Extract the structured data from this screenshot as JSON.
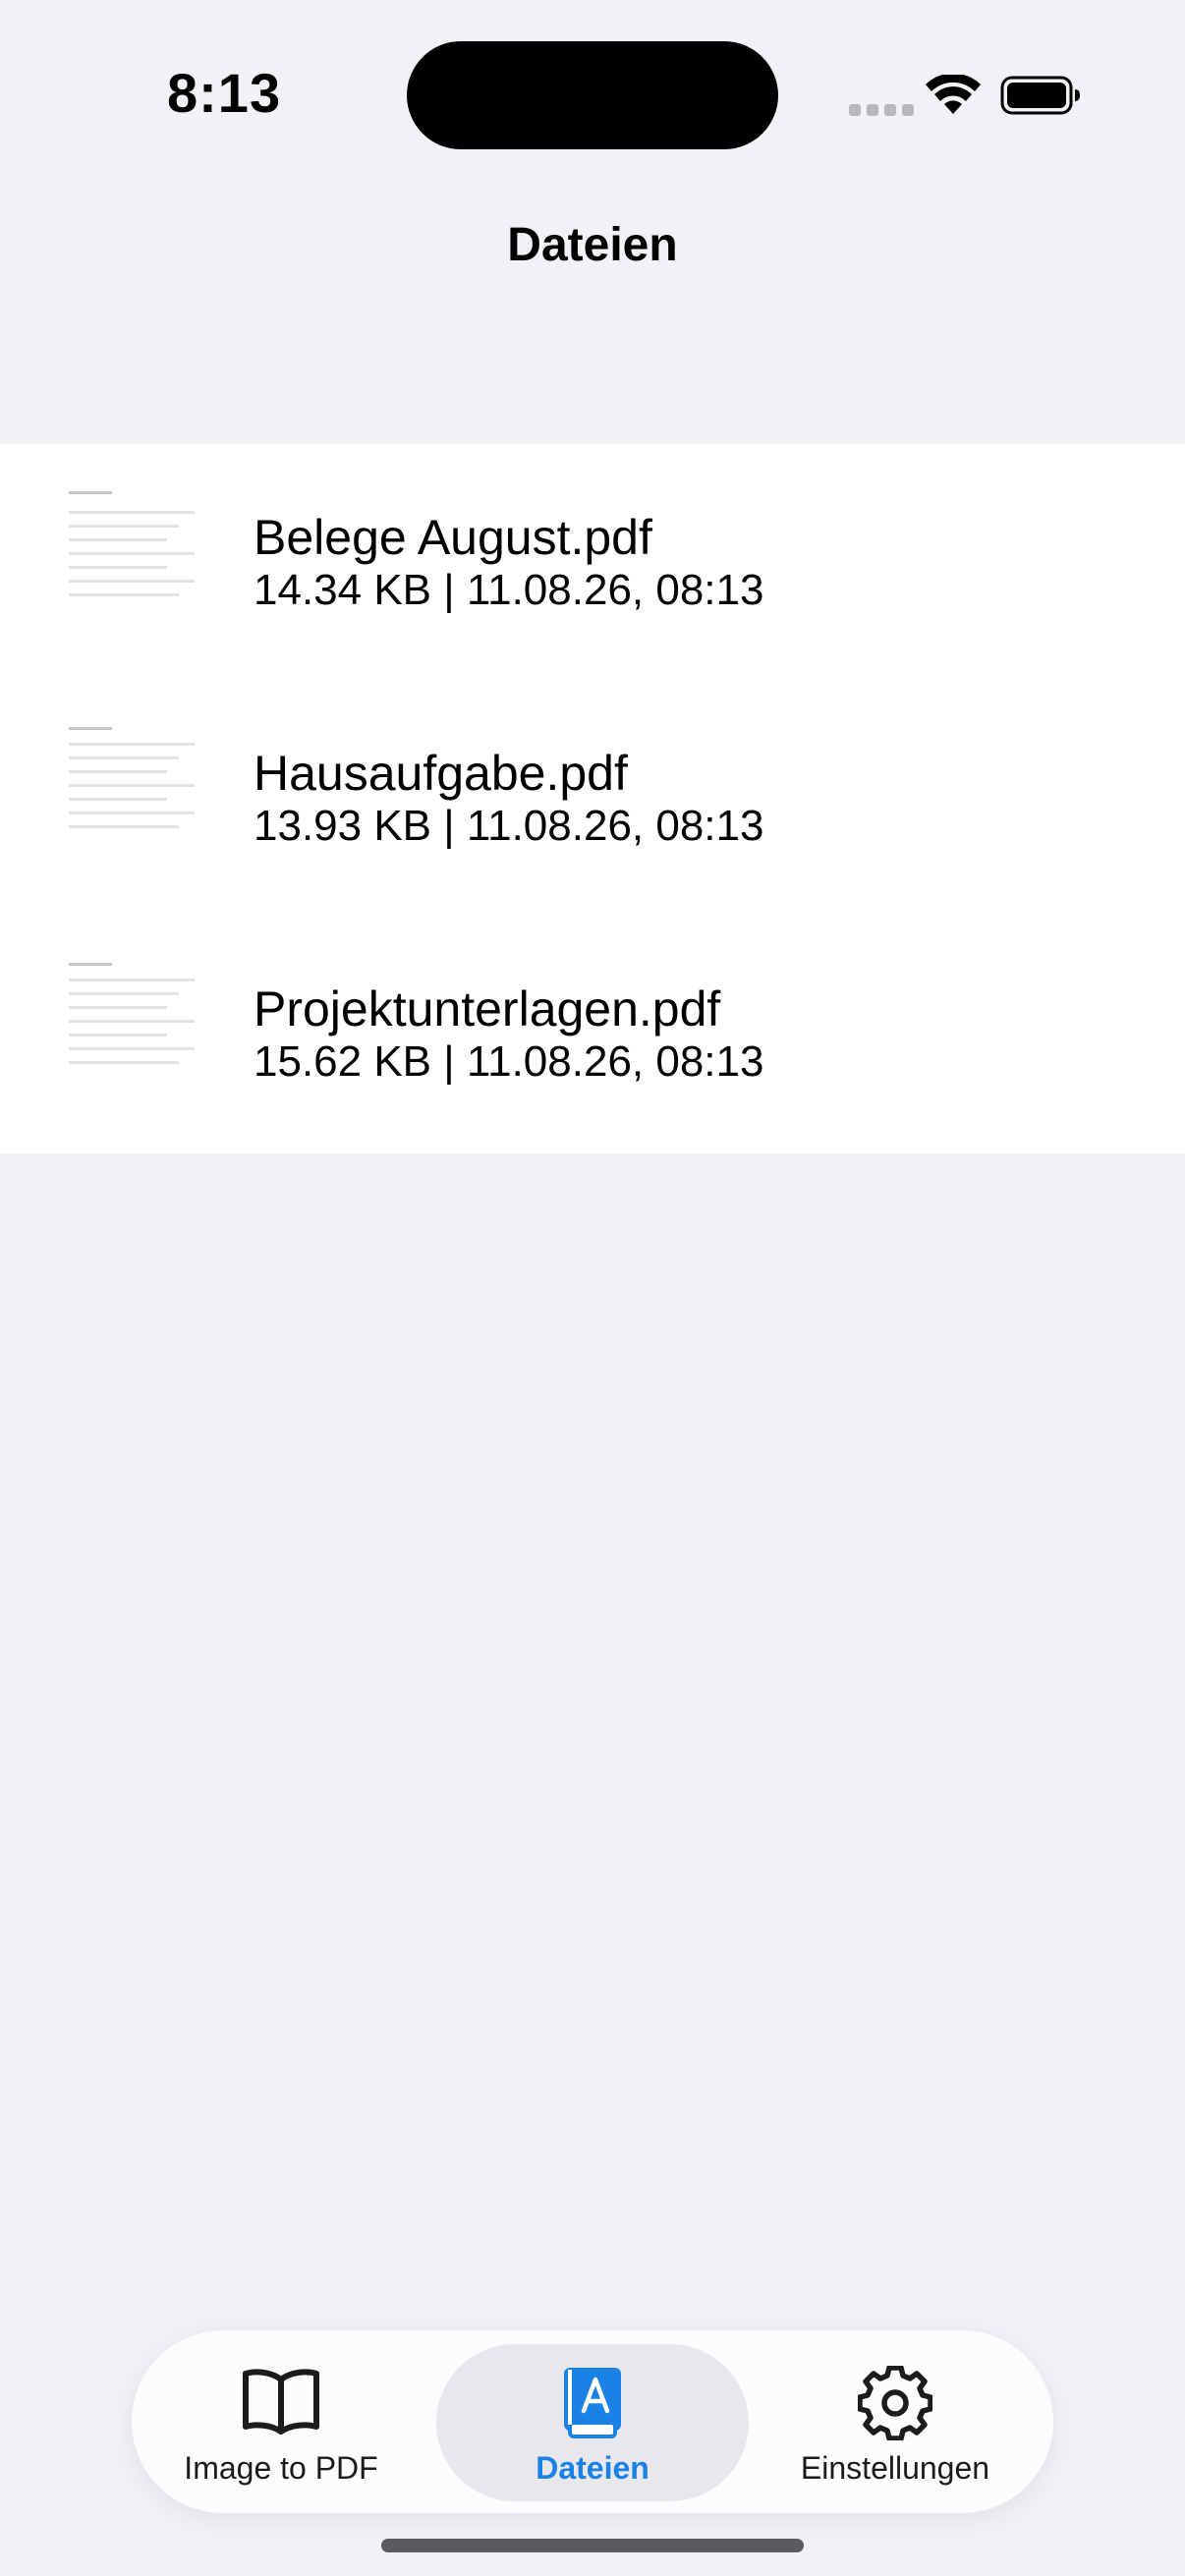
{
  "status_bar": {
    "time": "8:13"
  },
  "nav": {
    "title": "Dateien"
  },
  "files": [
    {
      "name": "Belege August.pdf",
      "meta": "14.34 KB | 11.08.26, 08:13"
    },
    {
      "name": "Hausaufgabe.pdf",
      "meta": "13.93 KB | 11.08.26, 08:13"
    },
    {
      "name": "Projektunterlagen.pdf",
      "meta": "15.62 KB | 11.08.26, 08:13"
    }
  ],
  "tab_bar": {
    "tabs": [
      {
        "label": "Image to PDF",
        "icon": "book-open-icon",
        "selected": false
      },
      {
        "label": "Dateien",
        "icon": "book-a-icon",
        "selected": true
      },
      {
        "label": "Einstellungen",
        "icon": "gear-icon",
        "selected": false
      }
    ]
  },
  "colors": {
    "background": "#F2F1F6",
    "accent": "#1A82E4",
    "list_background": "#FFFFFF",
    "selected_pill": "#E7E7EC"
  }
}
